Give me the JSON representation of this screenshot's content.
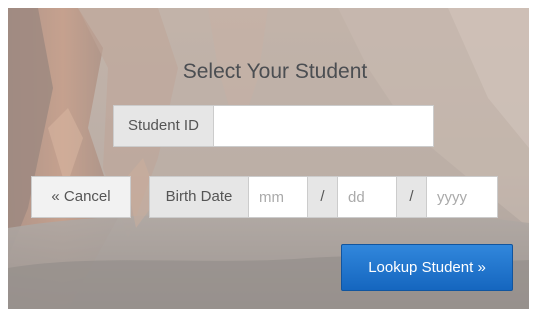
{
  "form": {
    "title": "Select Your Student",
    "student_id": {
      "label": "Student ID",
      "value": "",
      "placeholder": ""
    },
    "cancel_label": "« Cancel",
    "birth_date": {
      "label": "Birth Date",
      "month_placeholder": "mm",
      "day_placeholder": "dd",
      "year_placeholder": "yyyy",
      "separator": "/"
    },
    "lookup_label": "Lookup Student »"
  },
  "colors": {
    "primary_button": "#1f6fc4",
    "background_tint": "#8a7567"
  }
}
